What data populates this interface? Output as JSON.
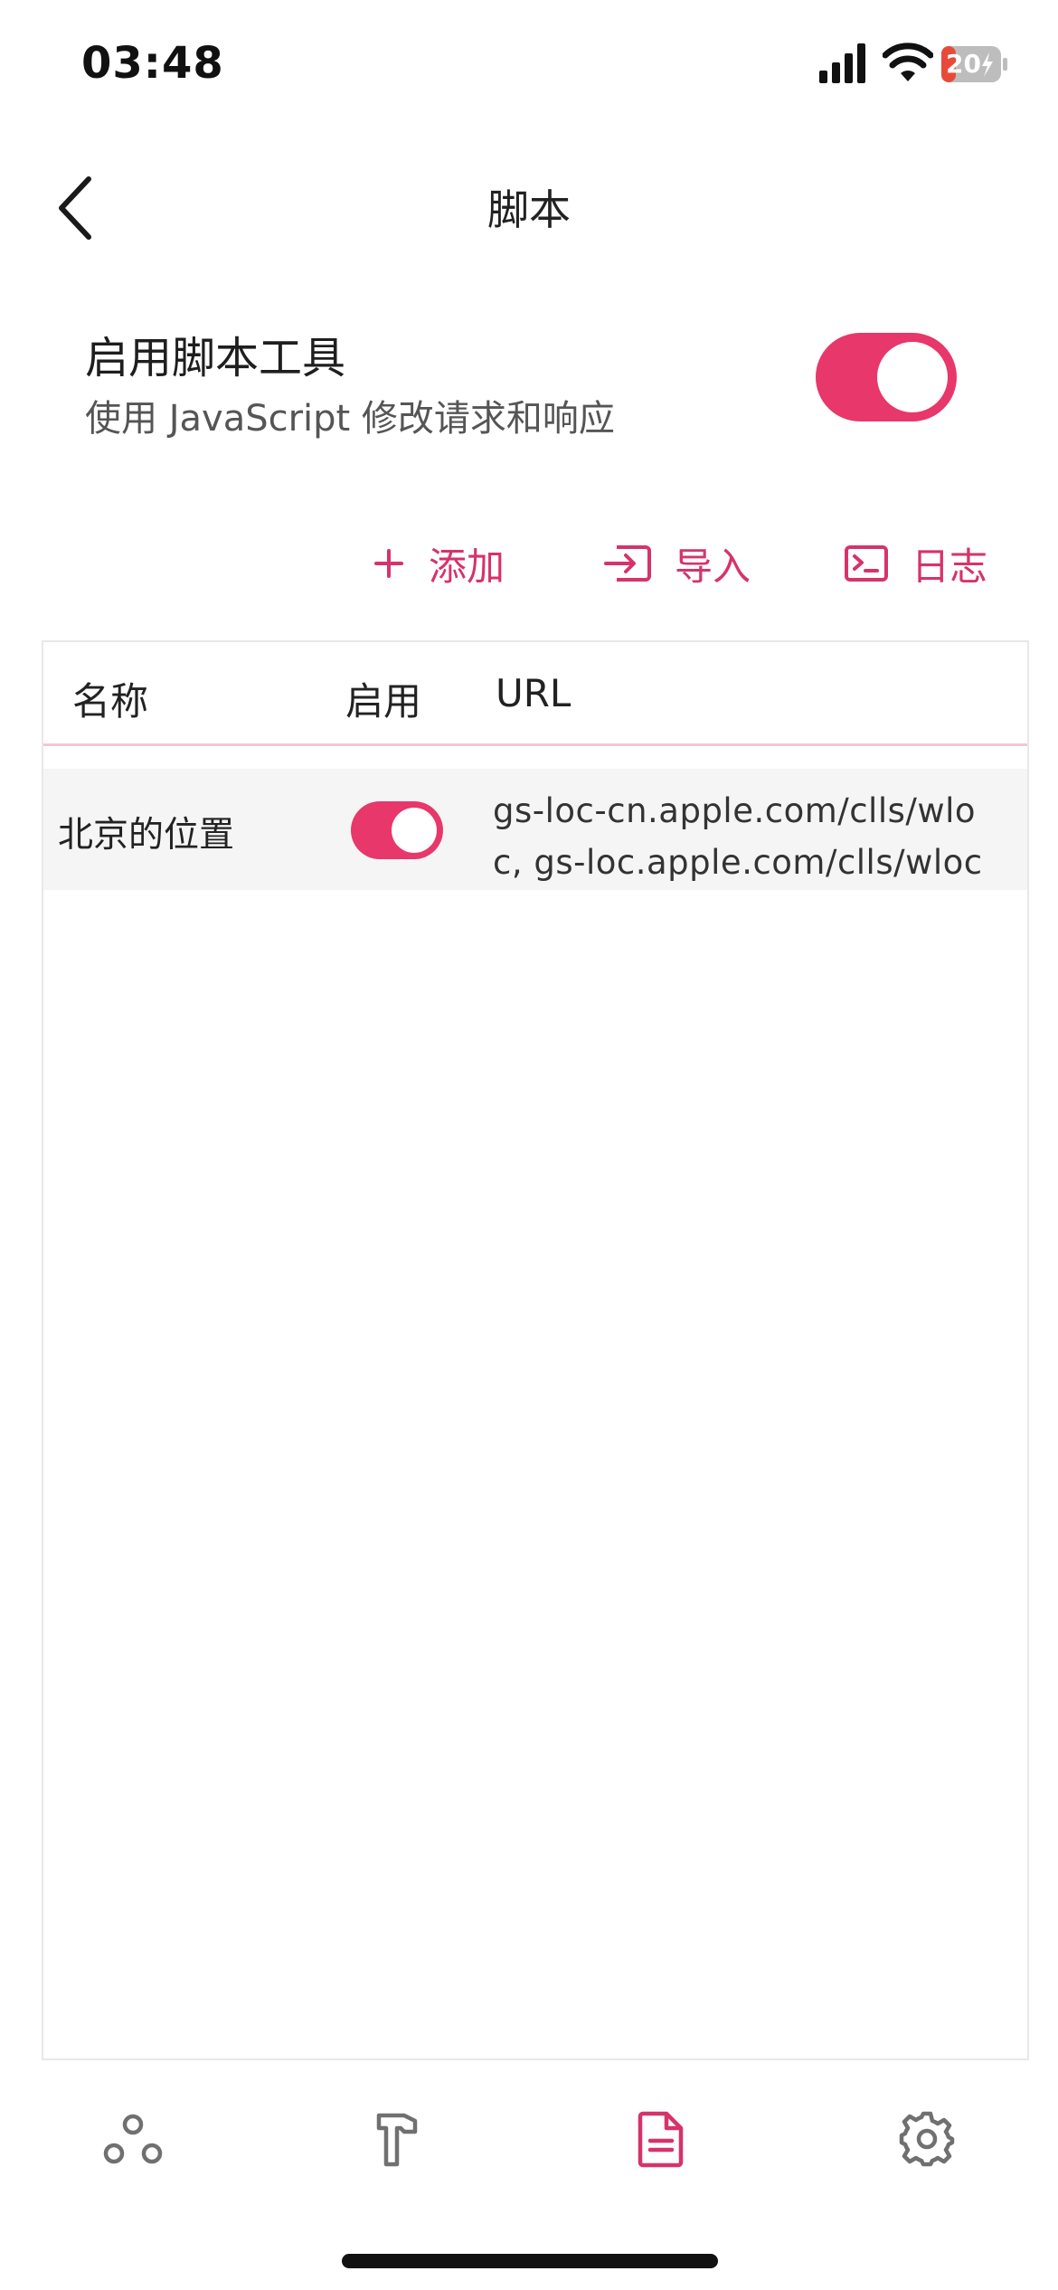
{
  "status_bar": {
    "time": "03:48",
    "battery": "20"
  },
  "nav": {
    "title": "脚本"
  },
  "enable_section": {
    "title": "启用脚本工具",
    "subtitle": "使用 JavaScript 修改请求和响应",
    "enabled": true
  },
  "actions": [
    {
      "label": "添加",
      "icon": "plus-icon"
    },
    {
      "label": "导入",
      "icon": "import-icon"
    },
    {
      "label": "日志",
      "icon": "terminal-icon"
    }
  ],
  "table": {
    "columns": [
      "名称",
      "启用",
      "URL"
    ],
    "rows": [
      {
        "name": "北京的位置",
        "enabled": true,
        "url_lines": [
          "gs-loc-cn.apple.com/clls/wlo",
          "c, gs-loc.apple.com/clls/wloc"
        ]
      }
    ]
  },
  "bottom_tabs": [
    {
      "icon": "network-nodes-icon",
      "active": false
    },
    {
      "icon": "tools-hammer-icon",
      "active": false
    },
    {
      "icon": "document-icon",
      "active": true
    },
    {
      "icon": "gear-icon",
      "active": false
    }
  ],
  "colors": {
    "accent": "#e8376a",
    "active_tab": "#d6336b",
    "inactive_tab": "#707070"
  }
}
